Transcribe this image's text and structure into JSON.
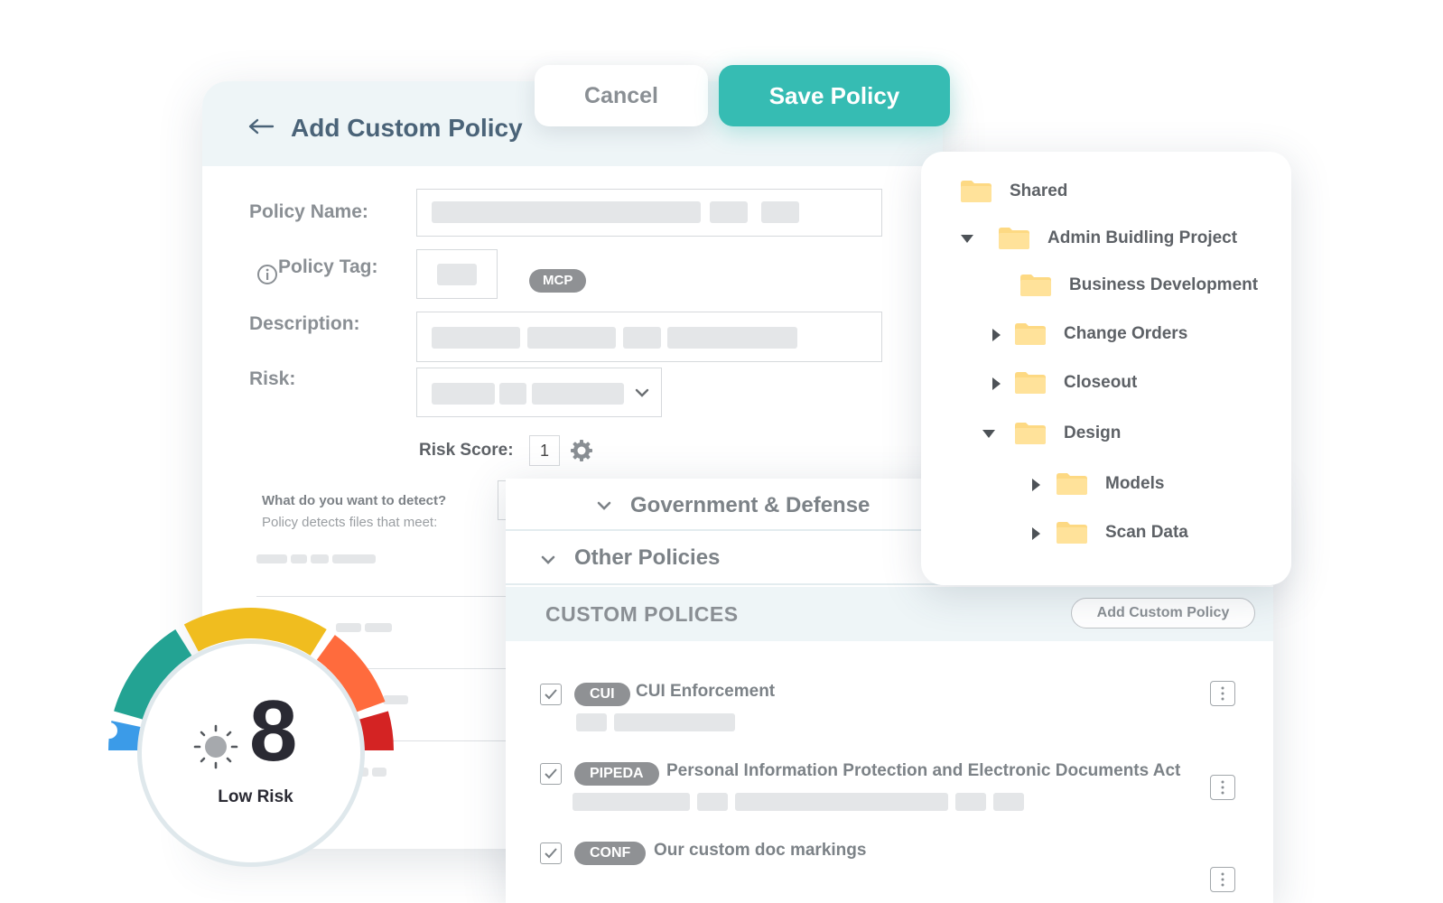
{
  "header": {
    "title": "Add Custom Policy"
  },
  "actions": {
    "cancel_label": "Cancel",
    "save_label": "Save Policy"
  },
  "form": {
    "policy_name_label": "Policy Name:",
    "policy_tag_label": "Policy Tag:",
    "policy_tag_pill": "MCP",
    "description_label": "Description:",
    "risk_label": "Risk:",
    "risk_score_label": "Risk Score:",
    "risk_score_value": "1",
    "detect_question": "What do you want to detect?",
    "detect_subtitle": "Policy detects files that meet:"
  },
  "categories": [
    {
      "label": "Government & Defense"
    },
    {
      "label": "Other Policies"
    }
  ],
  "custom_policies": {
    "title": "CUSTOM POLICES",
    "add_label": "Add Custom Policy",
    "items": [
      {
        "tag": "CUI",
        "name": "CUI Enforcement",
        "checked": true
      },
      {
        "tag": "PIPEDA",
        "name": "Personal Information Protection and Electronic Documents Act",
        "checked": true
      },
      {
        "tag": "CONF",
        "name": "Our custom doc markings",
        "checked": true
      }
    ]
  },
  "folder_tree": [
    {
      "label": "Shared",
      "expander": "none"
    },
    {
      "label": "Admin Buidling Project",
      "expander": "expanded"
    },
    {
      "label": "Business Development",
      "expander": "none"
    },
    {
      "label": "Change Orders",
      "expander": "collapsed"
    },
    {
      "label": "Closeout",
      "expander": "collapsed"
    },
    {
      "label": "Design",
      "expander": "expanded"
    },
    {
      "label": "Models",
      "expander": "collapsed"
    },
    {
      "label": "Scan Data",
      "expander": "collapsed"
    }
  ],
  "gauge": {
    "value": "8",
    "label": "Low Risk",
    "segment_colors": [
      "#3b9be8",
      "#23a393",
      "#f0bd1f",
      "#ff6b3d",
      "#d42323"
    ]
  },
  "colors": {
    "accent": "#36bcb3",
    "folder": "#fdd983",
    "title": "#4a6378"
  },
  "icons": {
    "back": "arrow-left-icon",
    "info": "info-circle-icon",
    "settings": "gear-icon",
    "risk": "sun-icon"
  }
}
